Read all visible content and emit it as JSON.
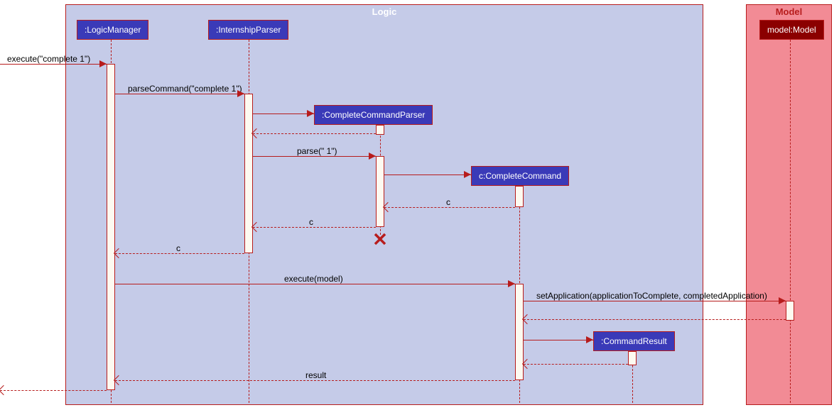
{
  "containers": {
    "logic": {
      "label": "Logic"
    },
    "model": {
      "label": "Model"
    }
  },
  "participants": {
    "logicManager": ":LogicManager",
    "internshipParser": ":InternshipParser",
    "completeCommandParser": ":CompleteCommandParser",
    "completeCommand": "c:CompleteCommand",
    "commandResult": ":CommandResult",
    "modelModel": "model:Model"
  },
  "messages": {
    "m1": "execute(\"complete 1\")",
    "m2": "parseCommand(\"complete 1\")",
    "m3": "parse(\" 1\")",
    "m4": "c",
    "m5": "c",
    "m6": "c",
    "m7": "execute(model)",
    "m8": "setApplication(applicationToComplete, completedApplication)",
    "m9": "result"
  },
  "chart_data": {
    "type": "sequence_diagram",
    "containers": [
      {
        "name": "Logic",
        "participants": [
          "LogicManager",
          "InternshipParser",
          "CompleteCommandParser",
          "CompleteCommand",
          "CommandResult"
        ]
      },
      {
        "name": "Model",
        "participants": [
          "model:Model"
        ]
      }
    ],
    "participants": [
      {
        "id": "LogicManager",
        "label": ":LogicManager"
      },
      {
        "id": "InternshipParser",
        "label": ":InternshipParser"
      },
      {
        "id": "CompleteCommandParser",
        "label": ":CompleteCommandParser",
        "created_by_message": 2
      },
      {
        "id": "CompleteCommand",
        "label": "c:CompleteCommand",
        "created_by_message": 4
      },
      {
        "id": "CommandResult",
        "label": ":CommandResult",
        "created_by_message": 9
      },
      {
        "id": "Model",
        "label": "model:Model"
      }
    ],
    "messages": [
      {
        "from": "external",
        "to": "LogicManager",
        "label": "execute(\"complete 1\")",
        "type": "sync"
      },
      {
        "from": "LogicManager",
        "to": "InternshipParser",
        "label": "parseCommand(\"complete 1\")",
        "type": "sync"
      },
      {
        "from": "InternshipParser",
        "to": "CompleteCommandParser",
        "label": "",
        "type": "create"
      },
      {
        "from": "CompleteCommandParser",
        "to": "InternshipParser",
        "label": "",
        "type": "return"
      },
      {
        "from": "InternshipParser",
        "to": "CompleteCommandParser",
        "label": "parse(\" 1\")",
        "type": "sync"
      },
      {
        "from": "CompleteCommandParser",
        "to": "CompleteCommand",
        "label": "",
        "type": "create"
      },
      {
        "from": "CompleteCommand",
        "to": "CompleteCommandParser",
        "label": "c",
        "type": "return"
      },
      {
        "from": "CompleteCommandParser",
        "to": "InternshipParser",
        "label": "c",
        "type": "return",
        "destroy": "CompleteCommandParser"
      },
      {
        "from": "InternshipParser",
        "to": "LogicManager",
        "label": "c",
        "type": "return"
      },
      {
        "from": "LogicManager",
        "to": "CompleteCommand",
        "label": "execute(model)",
        "type": "sync"
      },
      {
        "from": "CompleteCommand",
        "to": "Model",
        "label": "setApplication(applicationToComplete, completedApplication)",
        "type": "sync"
      },
      {
        "from": "Model",
        "to": "CompleteCommand",
        "label": "",
        "type": "return"
      },
      {
        "from": "CompleteCommand",
        "to": "CommandResult",
        "label": "",
        "type": "create"
      },
      {
        "from": "CommandResult",
        "to": "CompleteCommand",
        "label": "",
        "type": "return"
      },
      {
        "from": "CompleteCommand",
        "to": "LogicManager",
        "label": "result",
        "type": "return"
      },
      {
        "from": "LogicManager",
        "to": "external",
        "label": "",
        "type": "return"
      }
    ]
  }
}
